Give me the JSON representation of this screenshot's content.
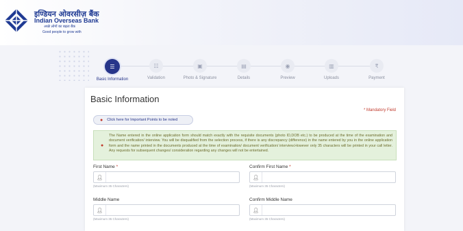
{
  "header": {
    "brand_hindi": "इण्डियन ओवरसीज़ बैंक",
    "brand_name": "Indian Overseas Bank",
    "tagline_hindi": "अच्छे लोगों का बढ़ता बैंक",
    "tagline_en": "Good people to grow with",
    "brand_color": "#1f3a93"
  },
  "stepper": {
    "active_color": "#27358a",
    "steps": [
      {
        "label": "Basic Information",
        "icon": "list-icon",
        "glyph": "☰",
        "active": true
      },
      {
        "label": "Validation",
        "icon": "checklist-icon",
        "glyph": "☷",
        "active": false
      },
      {
        "label": "Photo & Signature",
        "icon": "photo-icon",
        "glyph": "▣",
        "active": false
      },
      {
        "label": "Details",
        "icon": "document-icon",
        "glyph": "▤",
        "active": false
      },
      {
        "label": "Preview",
        "icon": "eye-icon",
        "glyph": "◉",
        "active": false
      },
      {
        "label": "Uploads",
        "icon": "upload-icon",
        "glyph": "▥",
        "active": false
      },
      {
        "label": "Payment",
        "icon": "rupee-icon",
        "glyph": "₹",
        "active": false
      }
    ]
  },
  "form": {
    "title": "Basic Information",
    "mandatory_note": "* Mandatory Field",
    "important_points_label": "Click here for Important Points to be noted",
    "notice_text": "The Name entered in the online application form should match exactly with the requisite documents (photo ID,DOB etc.) to be produced at the time of the examination and document verification/ interview. You will be disqualified from the selection process, if there is any discrepancy (difference) in the name entered by you in the online application form and the name printed in the documents produced at the time of examination/ document verification/ interview.However only 35 characters will be printed in your call letter. Any requests for subsequent changes/ consideration regarding any changes will not be entertained.",
    "fields": {
      "first_name": {
        "label": "First Name",
        "required": "*",
        "value": "",
        "hint": "(Maximum 35 Characters)"
      },
      "confirm_first_name": {
        "label": "Confirm First Name",
        "required": "*",
        "value": "",
        "hint": "(Maximum 35 Characters)"
      },
      "middle_name": {
        "label": "Middle Name",
        "value": "",
        "hint": "(Maximum 35 Characters)"
      },
      "confirm_middle_name": {
        "label": "Confirm Middle Name",
        "value": "",
        "hint": "(Maximum 35 Characters)"
      }
    },
    "field_icon": "user-icon"
  }
}
